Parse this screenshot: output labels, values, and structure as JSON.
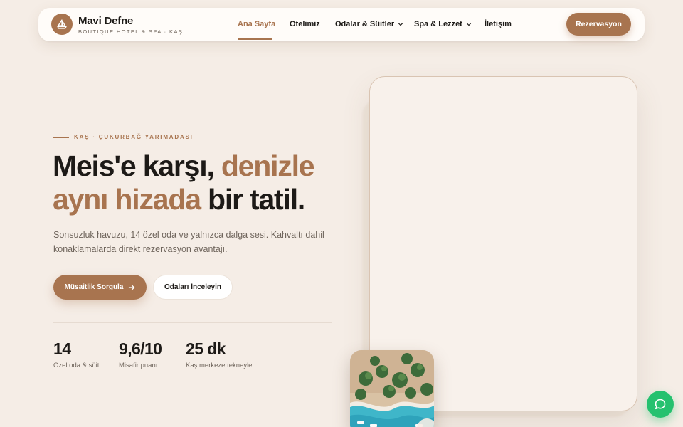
{
  "header": {
    "brand_name": "Mavi Defne",
    "brand_tagline": "BOUTIQUE HOTEL & SPA · KAŞ",
    "logo_icon": "sailboat-icon",
    "nav": [
      {
        "label": "Ana Sayfa",
        "active": true
      },
      {
        "label": "Otelimiz",
        "active": false
      },
      {
        "label": "Odalar & Süitler",
        "active": false,
        "dropdown": true
      },
      {
        "label": "Spa & Lezzet",
        "active": false,
        "dropdown": true
      },
      {
        "label": "İletişim",
        "active": false
      }
    ],
    "cta_label": "Rezervasyon"
  },
  "hero": {
    "eyebrow": "KAŞ · ÇUKURBAĞ YARIMADASI",
    "headline": {
      "part1": "Meis'e karşı, ",
      "accent1": "denizle aynı hizada",
      "part2": " bir tatil."
    },
    "lede": "Sonsuzluk havuzu, 14 özel oda ve yalnızca dalga sesi. Kahvaltı dahil konaklamalarda direkt rezervasyon avantajı.",
    "primary_button": "Müsaitlik Sorgula",
    "secondary_button": "Odaları İnceleyin",
    "stats": [
      {
        "value": "14",
        "label": "Özel oda & süit"
      },
      {
        "value": "9,6/10",
        "label": "Misafir puanı"
      },
      {
        "value": "25 dk",
        "label": "Kaş merkeze tekneyle"
      }
    ]
  },
  "colors": {
    "accent": "#a8744f",
    "background": "#f5ede6",
    "text": "#1d1a17",
    "muted": "#6f655c",
    "chat": "#25c16f"
  },
  "icons": {
    "arrow": "arrow-right-icon",
    "chevron": "chevron-down-icon",
    "chat": "chat-bubble-icon"
  }
}
